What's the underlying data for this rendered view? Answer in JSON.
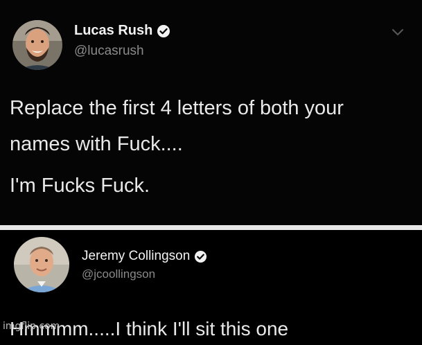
{
  "tweets": [
    {
      "author_name": "Lucas Rush",
      "author_handle": "@lucasrush",
      "verified": true,
      "lines": [
        "Replace the first 4 letters of both your",
        "names with Fuck....",
        "I'm Fucks Fuck."
      ]
    },
    {
      "author_name": "Jeremy Collingson",
      "author_handle": "@jcoollingson",
      "verified": true,
      "lines": [
        "Hmmmm.....I think I'll sit this one"
      ]
    }
  ],
  "watermark": "imgflip.com",
  "icons": {
    "verified": "verified-badge-icon",
    "menu": "chevron-down-icon"
  },
  "colors": {
    "background": "#000000",
    "text": "#e9e9e9",
    "handle": "#8a8a8a",
    "divider": "#e8e8e8"
  }
}
